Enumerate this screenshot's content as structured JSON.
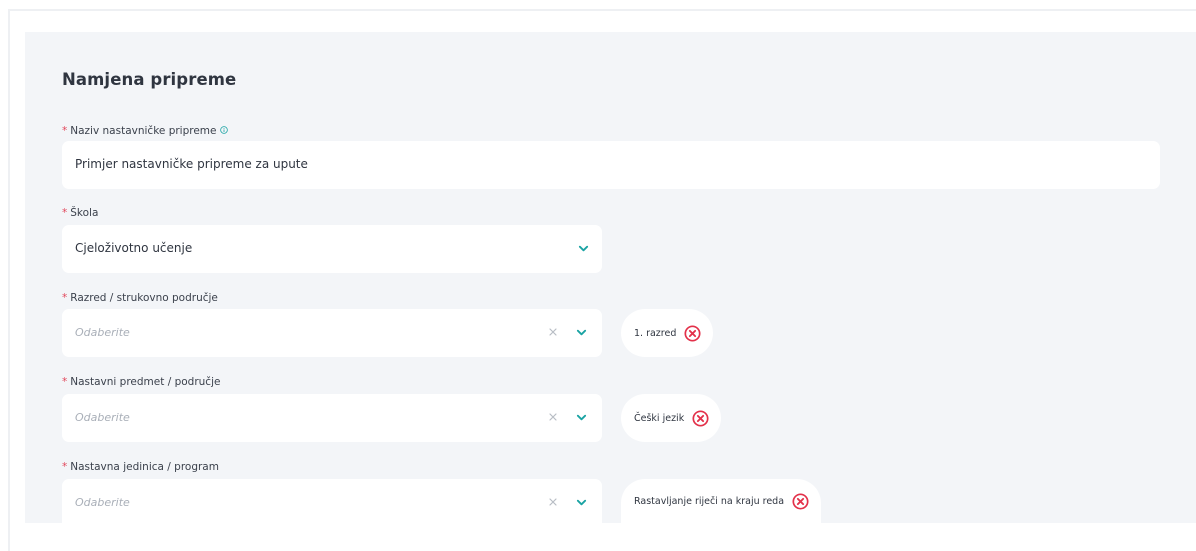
{
  "section": {
    "title": "Namjena pripreme"
  },
  "fields": {
    "naziv": {
      "required_mark": "*",
      "label": "Naziv nastavničke pripreme",
      "value": "Primjer nastavničke pripreme za upute",
      "info_icon": "info-icon"
    },
    "skola": {
      "required_mark": "*",
      "label": "Škola",
      "value": "Cjeloživotno učenje"
    },
    "razred": {
      "required_mark": "*",
      "label": "Razred / strukovno područje",
      "placeholder": "Odaberite",
      "selected_tag": "1. razred"
    },
    "predmet": {
      "required_mark": "*",
      "label": "Nastavni predmet / područje",
      "placeholder": "Odaberite",
      "selected_tag": "Češki jezik"
    },
    "jedinica": {
      "required_mark": "*",
      "label": "Nastavna jedinica / program",
      "placeholder": "Odaberite",
      "selected_tag": "Rastavljanje riječi na kraju reda"
    }
  },
  "colors": {
    "required": "#e2465a",
    "accent": "#1aa3a3",
    "remove": "#e3314a",
    "panel_background": "#f3f5f8"
  },
  "icons": {
    "dropdown": "chevron-down-icon",
    "clear": "clear-x-icon",
    "remove_tag": "remove-circle-icon"
  }
}
